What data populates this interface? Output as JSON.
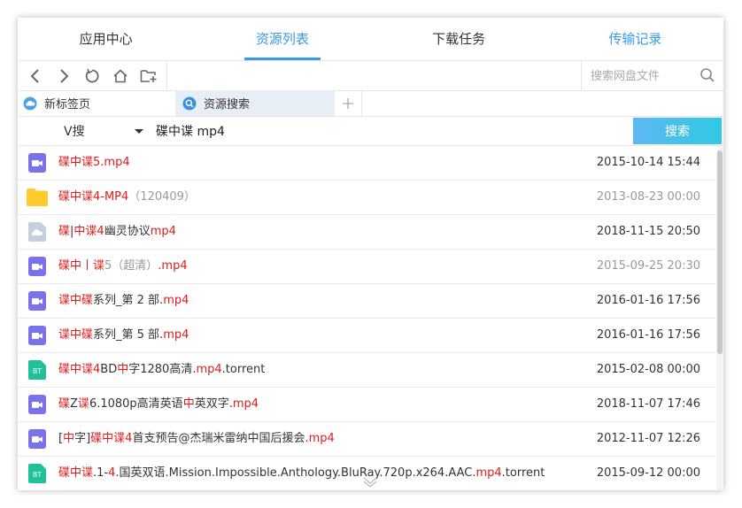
{
  "nav": {
    "tabs": [
      {
        "label": "应用中心"
      },
      {
        "label": "资源列表"
      },
      {
        "label": "下载任务"
      },
      {
        "label": "传输记录"
      }
    ],
    "active_index": 1
  },
  "toolbar": {
    "search_placeholder": "搜索网盘文件"
  },
  "browser_tabs": [
    {
      "label": "新标签页",
      "icon": "cloud-icon"
    },
    {
      "label": "资源搜索",
      "icon": "search-icon"
    }
  ],
  "query": {
    "engine": "V搜",
    "value": "碟中谍 mp4",
    "search_button": "搜索"
  },
  "results": [
    {
      "icon": "video-icon",
      "segments": [
        {
          "t": "碟中谍5.mp4",
          "c": "hl"
        }
      ],
      "date": "2015-10-14 15:44",
      "dim": false
    },
    {
      "icon": "folder-icon",
      "segments": [
        {
          "t": "碟中谍4-MP4",
          "c": "hl"
        },
        {
          "t": "（120409）",
          "c": "gray"
        }
      ],
      "date": "2013-08-23 00:00",
      "dim": true
    },
    {
      "icon": "cloud-file-icon",
      "segments": [
        {
          "t": "碟",
          "c": "hl"
        },
        {
          "t": "|",
          "c": ""
        },
        {
          "t": "中谍4",
          "c": "hl"
        },
        {
          "t": "幽灵协议",
          "c": ""
        },
        {
          "t": "mp4",
          "c": "hl"
        }
      ],
      "date": "2018-11-15 20:50",
      "dim": false
    },
    {
      "icon": "video-icon",
      "segments": [
        {
          "t": "碟中丨谍",
          "c": "hl"
        },
        {
          "t": "5（超清）",
          "c": "gray"
        },
        {
          "t": ".mp4",
          "c": "hl"
        }
      ],
      "date": "2015-09-25 20:30",
      "dim": true
    },
    {
      "icon": "video-icon",
      "segments": [
        {
          "t": "谍中碟",
          "c": "hl"
        },
        {
          "t": "系列_第 2 部.",
          "c": ""
        },
        {
          "t": "mp4",
          "c": "hl"
        }
      ],
      "date": "2016-01-16 17:56",
      "dim": false
    },
    {
      "icon": "video-icon",
      "segments": [
        {
          "t": "谍中碟",
          "c": "hl"
        },
        {
          "t": "系列_第 5 部.",
          "c": ""
        },
        {
          "t": "mp4",
          "c": "hl"
        }
      ],
      "date": "2016-01-16 17:56",
      "dim": false
    },
    {
      "icon": "bt-icon",
      "segments": [
        {
          "t": "碟中谍4",
          "c": "hl"
        },
        {
          "t": "BD",
          "c": ""
        },
        {
          "t": "中",
          "c": "hl"
        },
        {
          "t": "字1280高清.",
          "c": ""
        },
        {
          "t": "mp4",
          "c": "hl"
        },
        {
          "t": ".torrent",
          "c": ""
        }
      ],
      "date": "2015-02-08 00:00",
      "dim": false
    },
    {
      "icon": "video-icon",
      "segments": [
        {
          "t": "碟",
          "c": "hl"
        },
        {
          "t": "Z",
          "c": ""
        },
        {
          "t": "谍",
          "c": "hl"
        },
        {
          "t": "6.1080p高清英语",
          "c": ""
        },
        {
          "t": "中",
          "c": "hl"
        },
        {
          "t": "英双字.",
          "c": ""
        },
        {
          "t": "mp4",
          "c": "hl"
        }
      ],
      "date": "2018-11-07 17:46",
      "dim": false
    },
    {
      "icon": "video-icon",
      "segments": [
        {
          "t": "[",
          "c": ""
        },
        {
          "t": "中",
          "c": "hl"
        },
        {
          "t": "字]",
          "c": ""
        },
        {
          "t": "碟中谍4",
          "c": "hl"
        },
        {
          "t": "首支预告@杰瑞米雷纳中国后援会.",
          "c": ""
        },
        {
          "t": "mp4",
          "c": "hl"
        }
      ],
      "date": "2012-11-07 12:26",
      "dim": false
    },
    {
      "icon": "bt-icon",
      "segments": [
        {
          "t": "碟中谍",
          "c": "hl"
        },
        {
          "t": ".1-",
          "c": ""
        },
        {
          "t": "4",
          "c": "hl"
        },
        {
          "t": ".国英双语.Mission.Impossible.Anthology.BluRay.720p.x264.AAC.",
          "c": ""
        },
        {
          "t": "mp4",
          "c": "hl"
        },
        {
          "t": ".torrent",
          "c": ""
        }
      ],
      "date": "2015-09-12 00:00",
      "dim": false
    }
  ],
  "colors": {
    "accent": "#3a9ae8",
    "highlight": "#e01b1b",
    "video_icon": "#7b72ea",
    "folder_icon": "#ffcb2f",
    "bt_icon": "#1fc09a"
  }
}
